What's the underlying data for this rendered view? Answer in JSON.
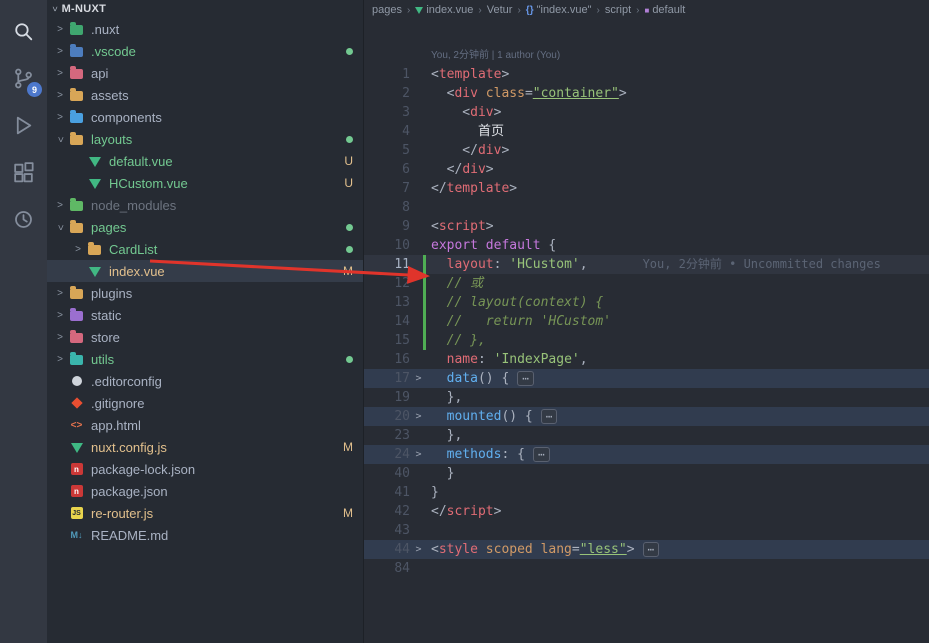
{
  "activity_bar": {
    "badge": "9",
    "icons": [
      "search-icon",
      "source-control-icon",
      "run-debug-icon",
      "extensions-icon",
      "history-icon"
    ]
  },
  "sidebar": {
    "title": "M-NUXT",
    "items": [
      {
        "label": ".nuxt",
        "level": 0,
        "chev": "right",
        "icon": "folder",
        "icon_color": "#3fa66f",
        "name_color": "default"
      },
      {
        "label": ".vscode",
        "level": 0,
        "chev": "right",
        "icon": "folder",
        "icon_color": "#4d7dbe",
        "name_color": "added",
        "dot": true
      },
      {
        "label": "api",
        "level": 0,
        "chev": "right",
        "icon": "folder",
        "icon_color": "#d4687e",
        "name_color": "default"
      },
      {
        "label": "assets",
        "level": 0,
        "chev": "right",
        "icon": "folder",
        "icon_color": "#d8a657",
        "name_color": "default"
      },
      {
        "label": "components",
        "level": 0,
        "chev": "right",
        "icon": "folder",
        "icon_color": "#4aa0e0",
        "name_color": "default"
      },
      {
        "label": "layouts",
        "level": 0,
        "chev": "down",
        "icon": "folder",
        "icon_color": "#d8a657",
        "name_color": "added",
        "dot": true
      },
      {
        "label": "default.vue",
        "level": 1,
        "icon": "vue",
        "name_color": "added",
        "badge": "U"
      },
      {
        "label": "HCustom.vue",
        "level": 1,
        "icon": "vue",
        "name_color": "added",
        "badge": "U"
      },
      {
        "label": "node_modules",
        "level": 0,
        "chev": "right",
        "icon": "folder",
        "icon_color": "#5fb865",
        "name_color": "dim"
      },
      {
        "label": "pages",
        "level": 0,
        "chev": "down",
        "icon": "folder",
        "icon_color": "#d8a657",
        "name_color": "added",
        "dot": true
      },
      {
        "label": "CardList",
        "level": 1,
        "chev": "right",
        "icon": "folder",
        "icon_color": "#d8a657",
        "name_color": "added",
        "dot": true
      },
      {
        "label": "index.vue",
        "level": 1,
        "icon": "vue",
        "name_color": "modified",
        "badge": "M",
        "selected": true
      },
      {
        "label": "plugins",
        "level": 0,
        "chev": "right",
        "icon": "folder",
        "icon_color": "#d8a657",
        "name_color": "default"
      },
      {
        "label": "static",
        "level": 0,
        "chev": "right",
        "icon": "folder",
        "icon_color": "#9b6fd0",
        "name_color": "default"
      },
      {
        "label": "store",
        "level": 0,
        "chev": "right",
        "icon": "folder",
        "icon_color": "#d4687e",
        "name_color": "default"
      },
      {
        "label": "utils",
        "level": 0,
        "chev": "right",
        "icon": "folder",
        "icon_color": "#3ab5ac",
        "name_color": "added",
        "dot": true
      },
      {
        "label": ".editorconfig",
        "level": 0,
        "icon": "editorconfig",
        "name_color": "default"
      },
      {
        "label": ".gitignore",
        "level": 0,
        "icon": "git",
        "name_color": "default"
      },
      {
        "label": "app.html",
        "level": 0,
        "icon": "html",
        "name_color": "default"
      },
      {
        "label": "nuxt.config.js",
        "level": 0,
        "icon": "nuxt",
        "name_color": "modified",
        "badge": "M"
      },
      {
        "label": "package-lock.json",
        "level": 0,
        "icon": "npm",
        "name_color": "default"
      },
      {
        "label": "package.json",
        "level": 0,
        "icon": "npm",
        "name_color": "default"
      },
      {
        "label": "re-router.js",
        "level": 0,
        "icon": "js",
        "name_color": "modified",
        "badge": "M"
      },
      {
        "label": "README.md",
        "level": 0,
        "icon": "md",
        "name_color": "default"
      }
    ]
  },
  "breadcrumbs": {
    "items": [
      {
        "label": "pages"
      },
      {
        "label": "index.vue",
        "icon": "vue"
      },
      {
        "label": "Vetur"
      },
      {
        "label": "\"index.vue\"",
        "icon": "braces",
        "glyph": "{}"
      },
      {
        "label": "script"
      },
      {
        "label": "default",
        "icon": "symbol",
        "glyph": "■"
      }
    ]
  },
  "editor": {
    "codelens": "You, 2分钟前 | 1 author (You)",
    "fold_ellipsis": "⋯",
    "lines": [
      {
        "n": 1,
        "t": [
          [
            "p",
            "<"
          ],
          [
            "tag",
            "template"
          ],
          [
            "p",
            ">"
          ]
        ]
      },
      {
        "n": 2,
        "t": [
          [
            "p",
            "  <"
          ],
          [
            "tag",
            "div"
          ],
          [
            "attr",
            " class"
          ],
          [
            "p",
            "="
          ],
          [
            "strU",
            "\"container\""
          ],
          [
            "p",
            ">"
          ]
        ]
      },
      {
        "n": 3,
        "t": [
          [
            "p",
            "    <"
          ],
          [
            "tag",
            "div"
          ],
          [
            "p",
            ">"
          ]
        ]
      },
      {
        "n": 4,
        "t": [
          [
            "cjk",
            "      首页"
          ]
        ]
      },
      {
        "n": 5,
        "t": [
          [
            "p",
            "    </"
          ],
          [
            "tag",
            "div"
          ],
          [
            "p",
            ">"
          ]
        ]
      },
      {
        "n": 6,
        "t": [
          [
            "p",
            "  </"
          ],
          [
            "tag",
            "div"
          ],
          [
            "p",
            ">"
          ]
        ]
      },
      {
        "n": 7,
        "t": [
          [
            "p",
            "</"
          ],
          [
            "tag",
            "template"
          ],
          [
            "p",
            ">"
          ]
        ]
      },
      {
        "n": 8,
        "t": []
      },
      {
        "n": 9,
        "t": [
          [
            "p",
            "<"
          ],
          [
            "tag",
            "script"
          ],
          [
            "p",
            ">"
          ]
        ]
      },
      {
        "n": 10,
        "t": [
          [
            "kw",
            "export default"
          ],
          [
            "p",
            " {"
          ]
        ]
      },
      {
        "n": 11,
        "t": [
          [
            "prop",
            "  layout"
          ],
          [
            "p",
            ": "
          ],
          [
            "str",
            "'HCustom'"
          ],
          [
            "p",
            ","
          ]
        ],
        "hl": "cur",
        "green": true,
        "blame": "You, 2分钟前 • Uncommitted changes"
      },
      {
        "n": 12,
        "t": [
          [
            "com",
            "  // 或"
          ]
        ],
        "green": true
      },
      {
        "n": 13,
        "t": [
          [
            "com",
            "  // layout(context) {"
          ]
        ],
        "green": true
      },
      {
        "n": 14,
        "t": [
          [
            "com",
            "  //   return 'HCustom'"
          ]
        ],
        "green": true
      },
      {
        "n": 15,
        "t": [
          [
            "com",
            "  // },"
          ]
        ],
        "green": true
      },
      {
        "n": 16,
        "t": [
          [
            "prop",
            "  name"
          ],
          [
            "p",
            ": "
          ],
          [
            "str",
            "'IndexPage'"
          ],
          [
            "p",
            ","
          ]
        ]
      },
      {
        "n": 17,
        "t": [
          [
            "func",
            "  data"
          ],
          [
            "p",
            "() {"
          ]
        ],
        "hl": "fold",
        "chev": true,
        "fold": true
      },
      {
        "n": 19,
        "t": [
          [
            "p",
            "  },"
          ]
        ]
      },
      {
        "n": 20,
        "t": [
          [
            "func",
            "  mounted"
          ],
          [
            "p",
            "() {"
          ]
        ],
        "hl": "fold",
        "chev": true,
        "fold": true
      },
      {
        "n": 23,
        "t": [
          [
            "p",
            "  },"
          ]
        ]
      },
      {
        "n": 24,
        "t": [
          [
            "func",
            "  methods"
          ],
          [
            "p",
            ": {"
          ]
        ],
        "hl": "fold",
        "chev": true,
        "fold": true
      },
      {
        "n": 40,
        "t": [
          [
            "p",
            "  }"
          ]
        ]
      },
      {
        "n": 41,
        "t": [
          [
            "p",
            "}"
          ]
        ]
      },
      {
        "n": 42,
        "t": [
          [
            "p",
            "</"
          ],
          [
            "tag",
            "script"
          ],
          [
            "p",
            ">"
          ]
        ]
      },
      {
        "n": 43,
        "t": []
      },
      {
        "n": 44,
        "t": [
          [
            "p",
            "<"
          ],
          [
            "tag",
            "style"
          ],
          [
            "attr",
            " scoped lang"
          ],
          [
            "p",
            "="
          ],
          [
            "strU",
            "\"less\""
          ],
          [
            "p",
            ">"
          ]
        ],
        "hl": "fold",
        "chev": true,
        "fold": true
      },
      {
        "n": 84,
        "t": []
      }
    ]
  },
  "colors": {
    "added_green": "#73c991",
    "modified_yellow": "#e2c08d",
    "vue_green": "#41b883",
    "arrow_red": "#e0342b",
    "badge_blue": "#4d78cc"
  }
}
